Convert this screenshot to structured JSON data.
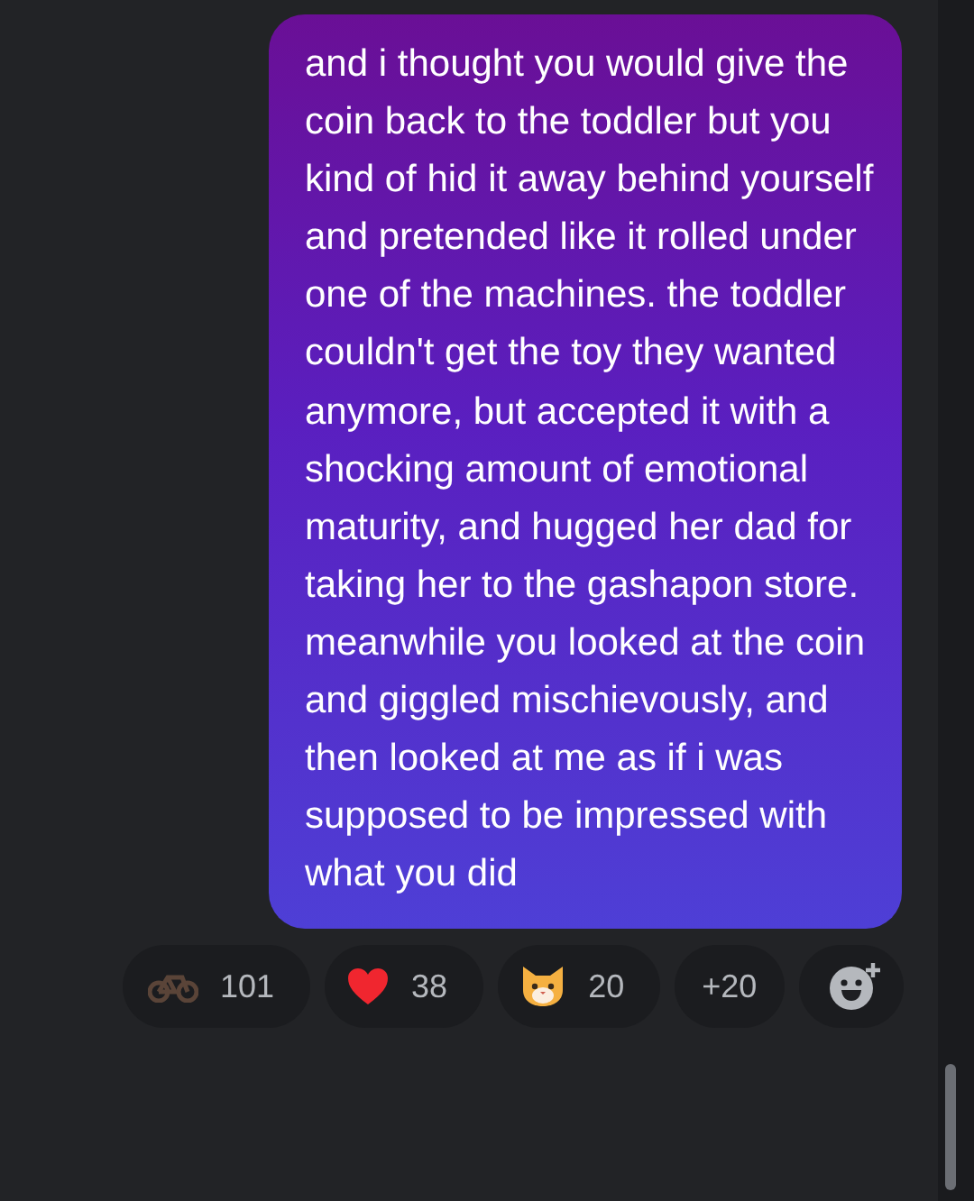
{
  "message": {
    "text": "and i thought you would give the coin back to the toddler but you kind of hid it away behind yourself and pretended like it rolled under one of the machines. the toddler couldn't get the toy they wanted anymore, but accepted it with a shocking amount of emotional maturity, and hugged her dad for taking her to the gashapon store. meanwhile you looked at the coin and giggled mischievously, and then looked at me as if i was supposed to be impressed with what you did"
  },
  "reactions": [
    {
      "kind": "emoji",
      "count": "101"
    },
    {
      "kind": "emoji",
      "count": "38"
    },
    {
      "kind": "emoji",
      "count": "20"
    },
    {
      "kind": "more",
      "count": "+20"
    },
    {
      "kind": "add"
    }
  ]
}
